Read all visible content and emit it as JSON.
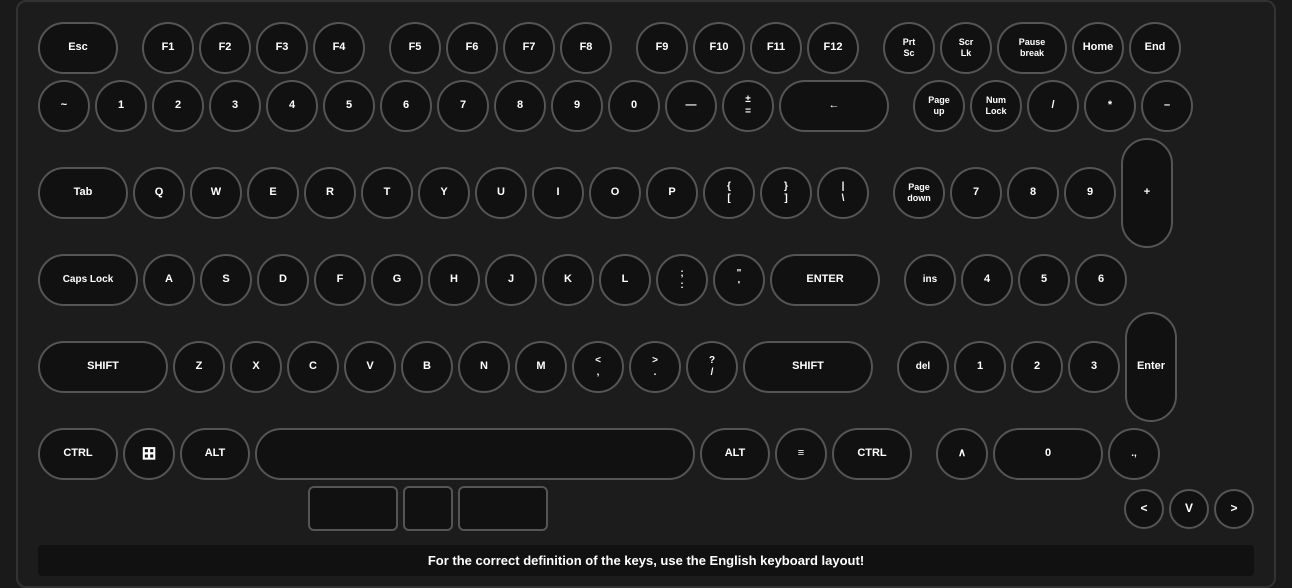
{
  "keyboard": {
    "footer": "For the correct definition of the keys, use the English keyboard layout!",
    "rows": {
      "fn": {
        "keys": [
          "Esc",
          "F1",
          "F2",
          "F3",
          "F4",
          "F5",
          "F6",
          "F7",
          "F8",
          "F9",
          "F10",
          "F11",
          "F12",
          "Prt\nSc",
          "Scr\nLk",
          "Pause\nbreak",
          "Home",
          "End"
        ]
      },
      "numbers": {
        "keys": [
          "~",
          "1",
          "2",
          "3",
          "4",
          "5",
          "6",
          "7",
          "8",
          "9",
          "0",
          "—",
          "±\n=",
          "←",
          "Page\nup",
          "Num\nLock",
          "/",
          "*",
          "–"
        ]
      },
      "qwerty": {
        "keys": [
          "Tab",
          "Q",
          "W",
          "E",
          "R",
          "T",
          "Y",
          "U",
          "I",
          "O",
          "P",
          "{\n[",
          "}\n]",
          "|\n\\",
          "Page\ndown",
          "7",
          "8",
          "9",
          "+"
        ]
      },
      "asdf": {
        "keys": [
          "Caps Lock",
          "A",
          "S",
          "D",
          "F",
          "G",
          "H",
          "J",
          "K",
          "L",
          ";\n:",
          "\"\n'",
          "ENTER",
          "ins",
          "4",
          "5",
          "6"
        ]
      },
      "zxcv": {
        "keys": [
          "SHIFT",
          "Z",
          "X",
          "C",
          "V",
          "B",
          "N",
          "M",
          "<\n,",
          ">\n.",
          "?\n/",
          "SHIFT",
          "del",
          "1",
          "2",
          "3",
          "Enter"
        ]
      },
      "bottom": {
        "keys": [
          "CTRL",
          "",
          "ALT",
          "",
          "ALT",
          "≡",
          "CTRL",
          "∧",
          "0",
          ".,"
        ]
      }
    }
  }
}
